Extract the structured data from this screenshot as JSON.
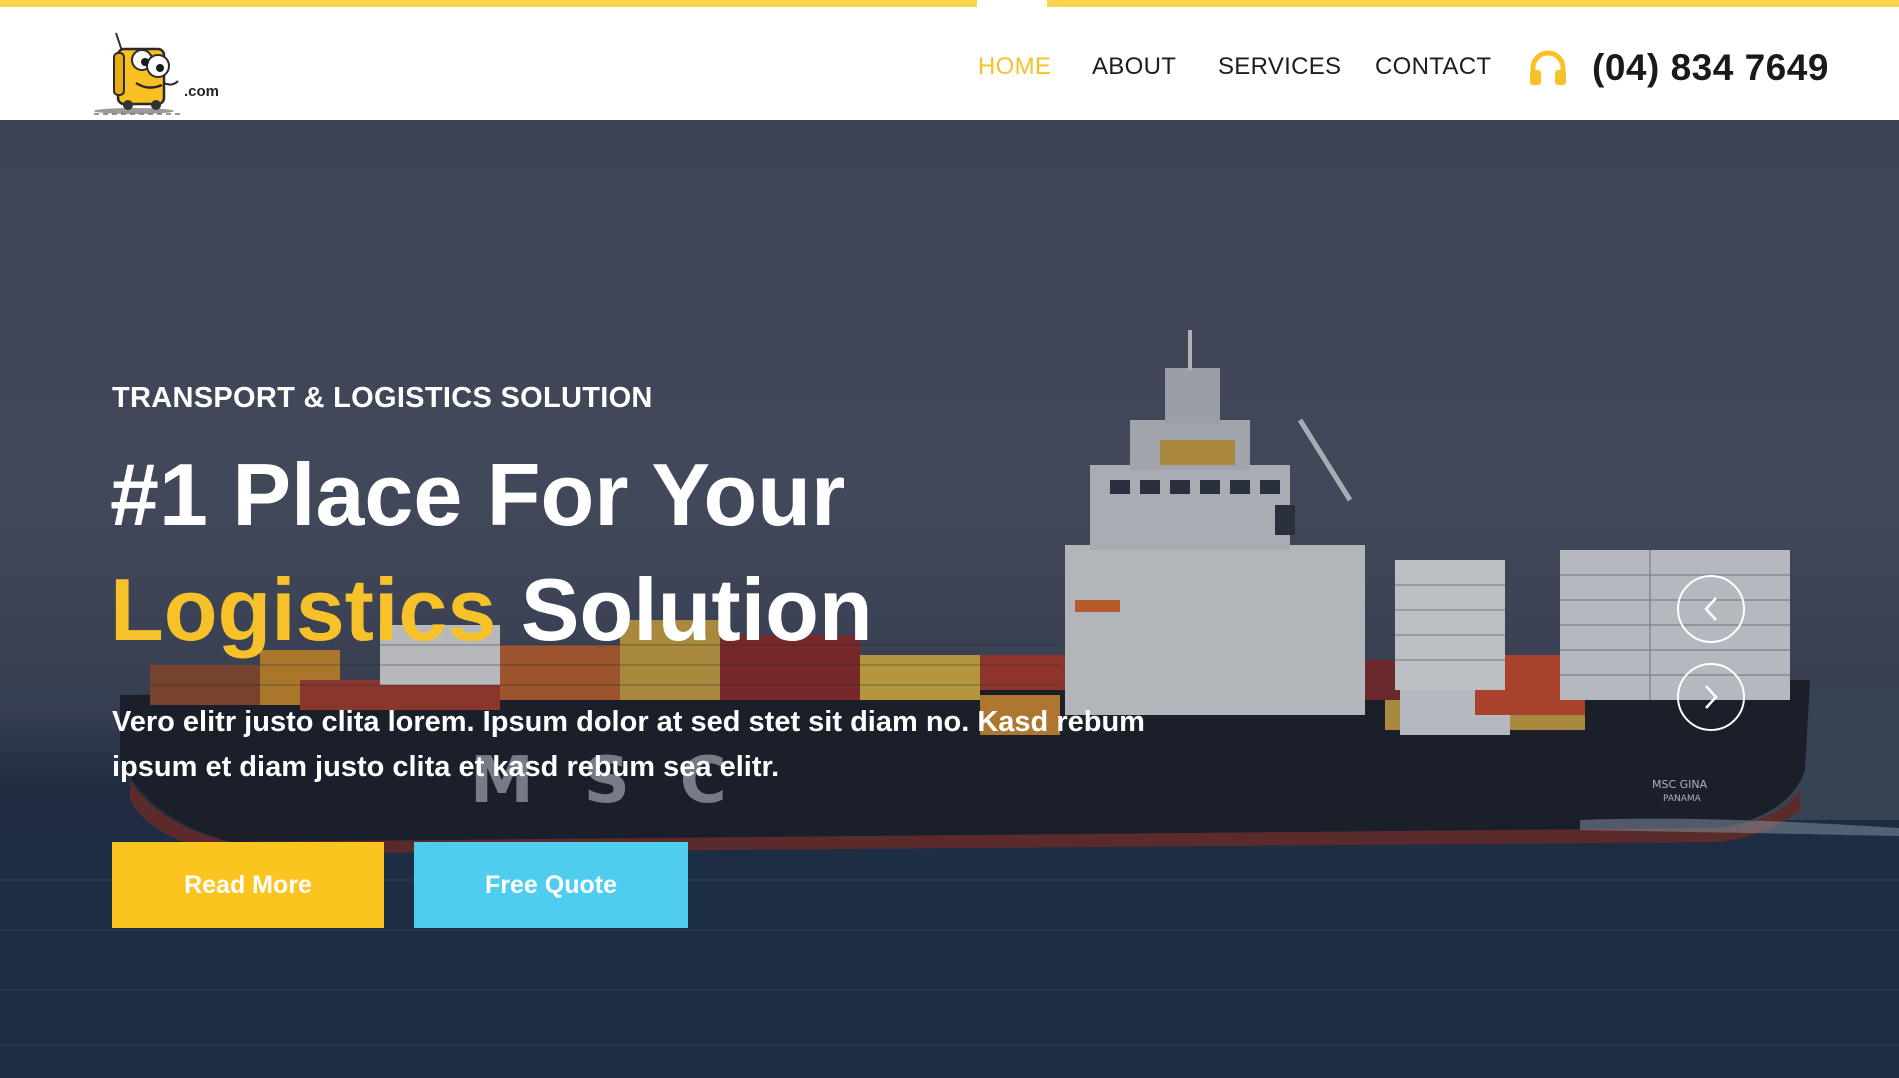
{
  "header": {
    "logo_text": ".com",
    "nav": [
      {
        "label": "HOME",
        "active": true
      },
      {
        "label": "ABOUT",
        "active": false
      },
      {
        "label": "SERVICES",
        "active": false
      },
      {
        "label": "CONTACT",
        "active": false
      }
    ],
    "phone_icon": "headphones-icon",
    "phone": "(04) 834 7649"
  },
  "hero": {
    "subtitle": "TRANSPORT & LOGISTICS SOLUTION",
    "headline_line1": "#1 Place For Your",
    "headline_highlight": "Logistics",
    "headline_rest": "Solution",
    "description": "Vero elitr justo clita lorem. Ipsum dolor at sed stet sit diam no. Kasd rebum ipsum et diam justo clita et kasd rebum sea elitr.",
    "buttons": {
      "read_more": "Read More",
      "free_quote": "Free Quote"
    },
    "carousel": {
      "prev_icon": "chevron-left-icon",
      "next_icon": "chevron-right-icon"
    },
    "ship_hull_text": "MSC",
    "ship_name": "MSC GINA",
    "ship_port": "PANAMA"
  },
  "colors": {
    "accent_yellow": "#f7c12a",
    "button_yellow": "#fbc41f",
    "button_cyan": "#4fcdee",
    "topbar_yellow": "#fdd44d"
  }
}
